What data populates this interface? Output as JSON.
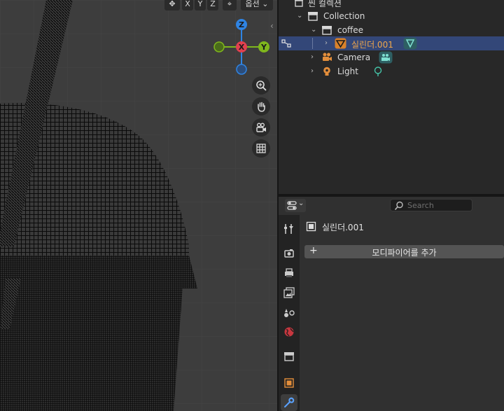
{
  "viewport": {
    "axis_buttons": [
      "X",
      "Y",
      "Z"
    ],
    "options_label": "옵션",
    "gizmo": {
      "z": "Z",
      "x": "X",
      "y": "Y"
    },
    "nav_icons": [
      "zoom-icon",
      "hand-pan-icon",
      "camera-icon",
      "grid-icon"
    ]
  },
  "outliner": {
    "scene_collection": "씬 컬렉션",
    "rows": [
      {
        "label": "Collection",
        "type": "collection"
      },
      {
        "label": "coffee",
        "type": "collection"
      },
      {
        "label": "실린더.001",
        "type": "mesh",
        "selected": true
      },
      {
        "label": "Camera",
        "type": "camera"
      },
      {
        "label": "Light",
        "type": "light"
      }
    ]
  },
  "properties": {
    "search_placeholder": "Search",
    "object_name": "실린더.001",
    "add_modifier_label": "모디파이어를 추가"
  },
  "colors": {
    "selected_row": "#334778",
    "object_orange": "#e38e3b",
    "gizmo_x": "#e0404f",
    "gizmo_y": "#7fb61d",
    "gizmo_z": "#2f84e3",
    "data_teal": "#45a99d"
  }
}
